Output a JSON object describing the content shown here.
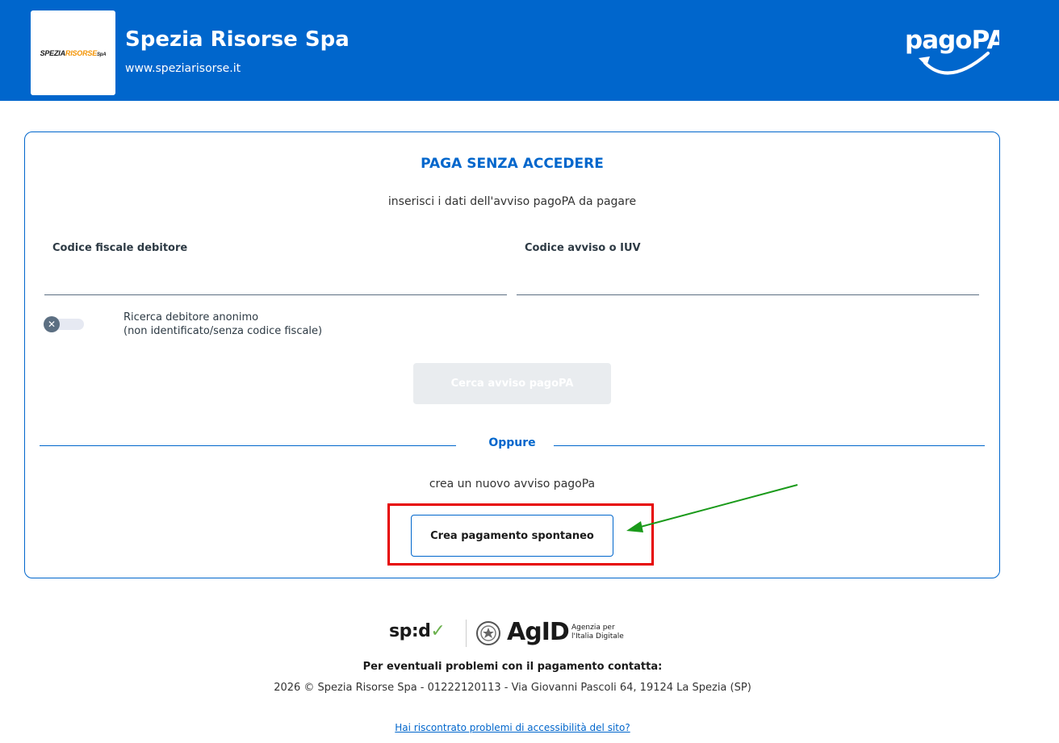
{
  "header": {
    "logo": {
      "part1": "SPEZIA",
      "part2": "RISORSE",
      "part3": "SpA"
    },
    "title": "Spezia Risorse Spa",
    "url": "www.speziarisorse.it",
    "brand_logo_text": "pagoPA",
    "background_color": "#0066cc"
  },
  "card": {
    "title": "PAGA SENZA ACCEDERE",
    "subtitle": "inserisci i dati dell'avviso pagoPA da pagare",
    "fields": {
      "codice_fiscale": {
        "label": "Codice fiscale debitore",
        "value": ""
      },
      "codice_avviso": {
        "label": "Codice avviso o IUV",
        "value": ""
      }
    },
    "toggle": {
      "state": "off",
      "line1": "Ricerca debitore anonimo",
      "line2": "(non identificato/senza codice fiscale)"
    },
    "search_button": "Cerca avviso pagoPA",
    "divider_label": "Oppure",
    "create_text": "crea un nuovo avviso pagoPa",
    "create_button": "Crea pagamento spontaneo",
    "accent_color": "#0066cc",
    "highlight_color": "#e60000",
    "arrow_color": "#1a9a1a"
  },
  "footer": {
    "spid_text": "sp:d",
    "agid_text": "AgID",
    "agid_desc_line1": "Agenzia per",
    "agid_desc_line2": "l'Italia Digitale",
    "contact_label": "Per eventuali problemi con il pagamento contatta:",
    "info": "2026 © Spezia Risorse Spa - 01222120113 - Via Giovanni Pascoli 64, 19124 La Spezia (SP)",
    "accessibility_link": "Hai riscontrato problemi di accessibilità del sito?"
  }
}
